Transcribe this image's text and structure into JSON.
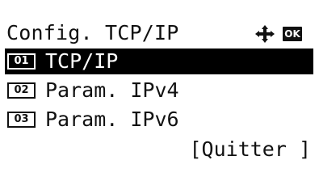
{
  "screen": {
    "title": "Config. TCP/IP",
    "nav_icon": "four-way-arrow-icon",
    "ok_label": "OK"
  },
  "menu": {
    "items": [
      {
        "number": "01",
        "label": "TCP/IP",
        "selected": true
      },
      {
        "number": "02",
        "label": "Param. IPv4",
        "selected": false
      },
      {
        "number": "03",
        "label": "Param. IPv6",
        "selected": false
      }
    ]
  },
  "softkey": {
    "label": "[Quitter ]"
  },
  "colors": {
    "foreground": "#111111",
    "background": "#ffffff",
    "selection": "#000000"
  }
}
